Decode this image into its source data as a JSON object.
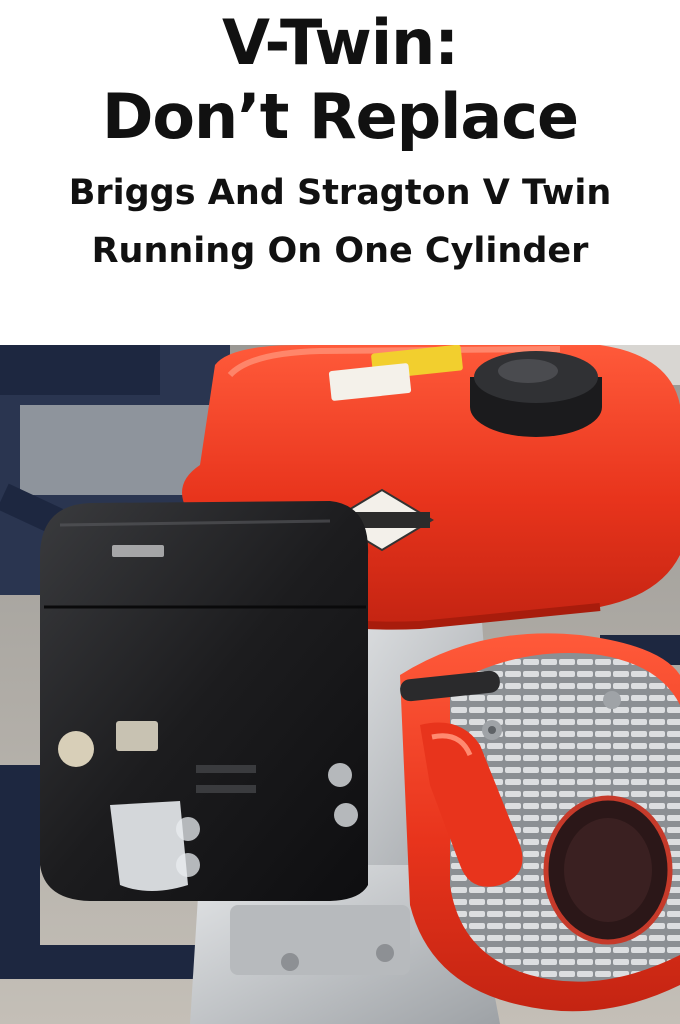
{
  "header": {
    "title_line1": "V-Twin:",
    "title_line2": "Don’t Replace",
    "subtitle_line1": "Briggs And Stragton V Twin",
    "subtitle_line2": "Running On One Cylinder"
  },
  "photo": {
    "subject": "engine-photo",
    "colors": {
      "shroud_red": "#e8341c",
      "shroud_highlight": "#ff6a4a",
      "air_filter_black": "#1c1c1e",
      "frame_navy": "#1d2740",
      "aluminum": "#c9cbcd",
      "floor": "#b9b4ac"
    }
  }
}
